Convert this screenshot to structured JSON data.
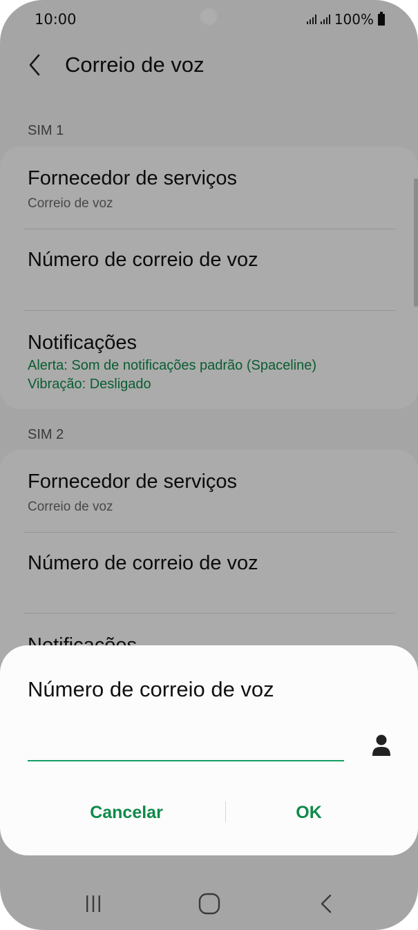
{
  "status_bar": {
    "time": "10:00",
    "battery": "100%",
    "icons": [
      "signal-icon",
      "signal-icon",
      "battery-icon"
    ]
  },
  "header": {
    "title": "Correio de voz",
    "back_icon": "chevron-left-icon"
  },
  "sim1": {
    "label": "SIM 1",
    "provider_title": "Fornecedor de serviços",
    "provider_sub": "Correio de voz",
    "number_title": "Número de correio de voz",
    "notifications_title": "Notificações",
    "notifications_alert": "Alerta: Som de notificações padrão (Spaceline)",
    "notifications_vibration": "Vibração: Desligado"
  },
  "sim2": {
    "label": "SIM 2",
    "provider_title": "Fornecedor de serviços",
    "provider_sub": "Correio de voz",
    "number_title": "Número de correio de voz",
    "notifications_title": "Notificações"
  },
  "dialog": {
    "title": "Número de correio de voz",
    "input_value": "",
    "contact_icon": "person-icon",
    "cancel_label": "Cancelar",
    "ok_label": "OK"
  },
  "navbar": {
    "icons": [
      "recent-apps-icon",
      "home-icon",
      "back-icon"
    ]
  },
  "colors": {
    "accent": "#0f8a4a",
    "input_underline": "#12a064",
    "dim_overlay": "rgba(0,0,0,0.32)"
  }
}
